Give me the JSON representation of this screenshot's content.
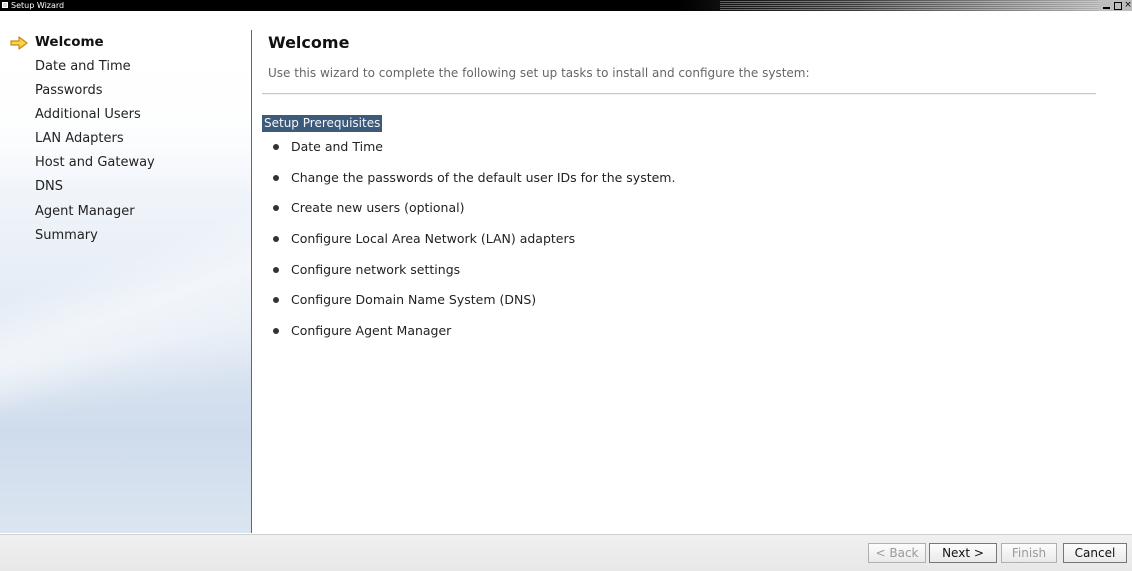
{
  "window": {
    "title": "Setup Wizard",
    "close_glyph": "×"
  },
  "sidebar": {
    "items": [
      {
        "label": "Welcome",
        "active": true
      },
      {
        "label": "Date and Time"
      },
      {
        "label": "Passwords"
      },
      {
        "label": "Additional Users"
      },
      {
        "label": "LAN Adapters"
      },
      {
        "label": "Host and Gateway"
      },
      {
        "label": "DNS"
      },
      {
        "label": "Agent Manager"
      },
      {
        "label": "Summary"
      }
    ]
  },
  "main": {
    "title": "Welcome",
    "intro": "Use this wizard to complete the following set up tasks to install and configure the system:",
    "section_label": "Setup Prerequisites",
    "tasks": [
      "Date and Time",
      "Change the passwords of the default user IDs for the system.",
      "Create new users (optional)",
      "Configure Local Area Network (LAN) adapters",
      "Configure network settings",
      "Configure Domain Name System (DNS)",
      "Configure Agent Manager"
    ]
  },
  "buttons": {
    "back": "< Back",
    "next": "Next >",
    "finish": "Finish",
    "cancel": "Cancel"
  },
  "colors": {
    "selection_bg": "#3d5a7a",
    "sidebar_gradient_end": "#cfdcec"
  },
  "icons": {
    "current_step": "arrow-right-icon"
  }
}
